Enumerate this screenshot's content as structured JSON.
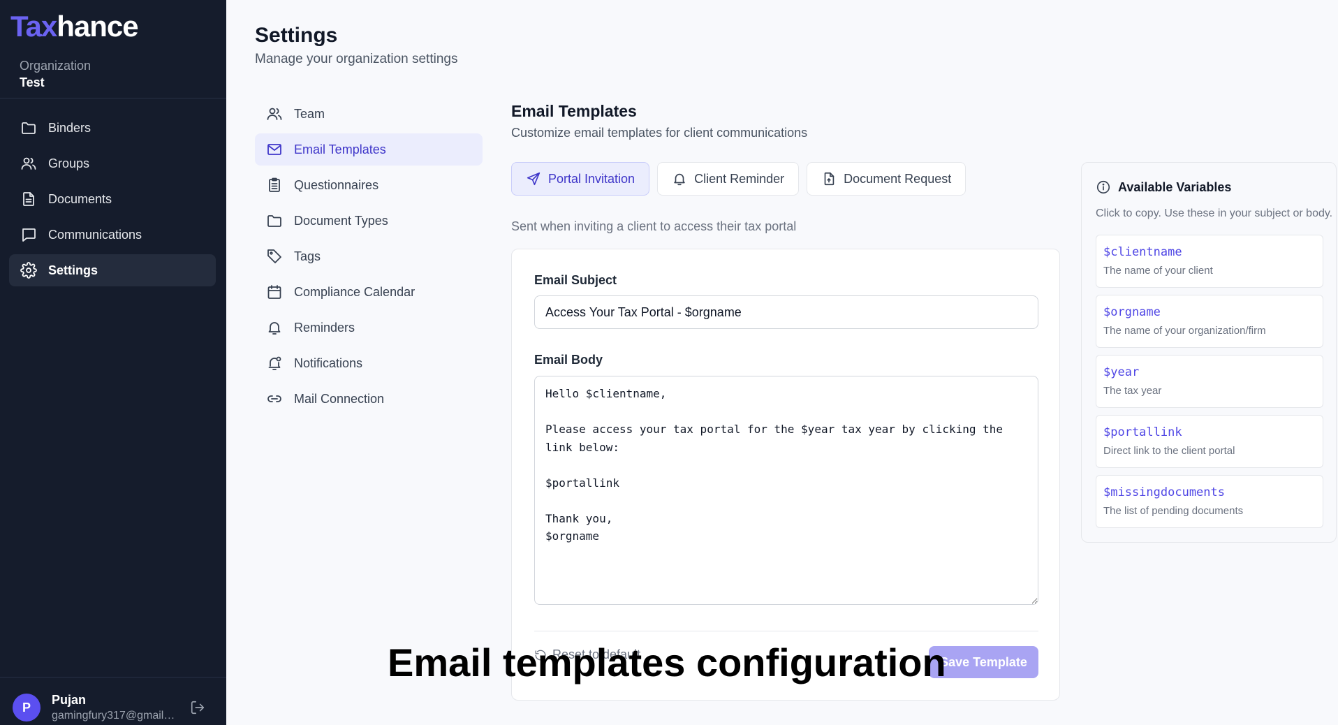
{
  "brand": {
    "part1": "Tax",
    "part2": "hance"
  },
  "org": {
    "label": "Organization",
    "name": "Test"
  },
  "sidebar": {
    "items": [
      {
        "label": "Binders",
        "icon": "folder-icon"
      },
      {
        "label": "Groups",
        "icon": "users-icon"
      },
      {
        "label": "Documents",
        "icon": "document-icon"
      },
      {
        "label": "Communications",
        "icon": "chat-icon"
      },
      {
        "label": "Settings",
        "icon": "gear-icon",
        "active": true
      }
    ]
  },
  "user": {
    "initial": "P",
    "name": "Pujan",
    "email": "gamingfury317@gmail.c..."
  },
  "header": {
    "title": "Settings",
    "subtitle": "Manage your organization settings"
  },
  "settings_nav": {
    "items": [
      {
        "label": "Team",
        "icon": "users-icon"
      },
      {
        "label": "Email Templates",
        "icon": "mail-icon",
        "active": true
      },
      {
        "label": "Questionnaires",
        "icon": "clipboard-icon"
      },
      {
        "label": "Document Types",
        "icon": "folder-icon"
      },
      {
        "label": "Tags",
        "icon": "tag-icon"
      },
      {
        "label": "Compliance Calendar",
        "icon": "calendar-icon"
      },
      {
        "label": "Reminders",
        "icon": "bell-icon"
      },
      {
        "label": "Notifications",
        "icon": "bell-ring-icon"
      },
      {
        "label": "Mail Connection",
        "icon": "link-icon"
      }
    ]
  },
  "main": {
    "title": "Email Templates",
    "subtitle": "Customize email templates for client communications",
    "tabs": [
      {
        "label": "Portal Invitation",
        "icon": "send-icon",
        "active": true
      },
      {
        "label": "Client Reminder",
        "icon": "bell-icon"
      },
      {
        "label": "Document Request",
        "icon": "file-icon"
      }
    ],
    "tab_description": "Sent when inviting a client to access their tax portal",
    "subject_label": "Email Subject",
    "subject_value": "Access Your Tax Portal - $orgname",
    "body_label": "Email Body",
    "body_value": "Hello $clientname,\n\nPlease access your tax portal for the $year tax year by clicking the link below:\n\n$portallink\n\nThank you,\n$orgname",
    "reset_label": "Reset to default",
    "save_label": "Save Template"
  },
  "variables": {
    "title": "Available Variables",
    "subtitle": "Click to copy. Use these in your subject or body.",
    "items": [
      {
        "name": "$clientname",
        "desc": "The name of your client"
      },
      {
        "name": "$orgname",
        "desc": "The name of your organization/firm"
      },
      {
        "name": "$year",
        "desc": "The tax year"
      },
      {
        "name": "$portallink",
        "desc": "Direct link to the client portal"
      },
      {
        "name": "$missingdocuments",
        "desc": "The list of pending documents"
      }
    ]
  },
  "caption": "Email templates configuration",
  "colors": {
    "sidebar_bg": "#151c2c",
    "accent": "#4f46e5",
    "active_bg": "#ebedfd",
    "save_disabled": "#a9a4f3"
  }
}
